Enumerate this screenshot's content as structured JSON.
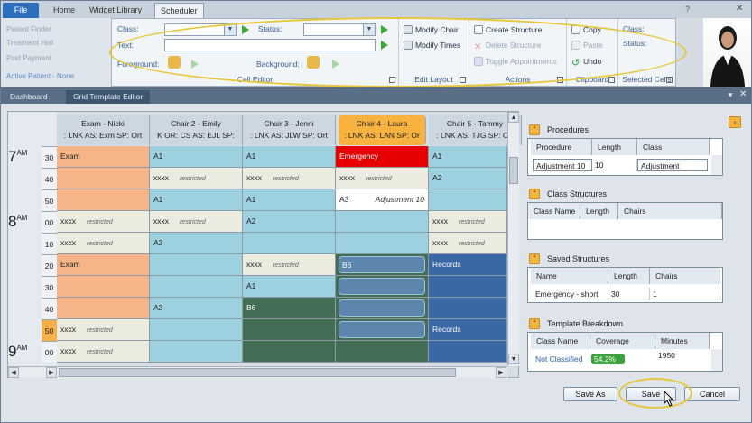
{
  "tabs": {
    "file": "File",
    "home": "Home",
    "widget": "Widget Library",
    "scheduler": "Scheduler"
  },
  "left_ribbon": [
    "Patient Finder",
    "Treatment Hist",
    "Post Payment",
    "Active Patient - None"
  ],
  "cell_editor": {
    "class_label": "Class:",
    "status_label": "Status:",
    "text_label": "Text:",
    "foreground_label": "Foreground:",
    "background_label": "Background:",
    "caption": "Cell Editor"
  },
  "edit_layout": {
    "modify_chair": "Modify Chair",
    "modify_times": "Modify Times",
    "caption": "Edit Layout"
  },
  "actions": {
    "create": "Create Structure",
    "delete": "Delete Structure",
    "toggle": "Toggle Appointments",
    "caption": "Actions"
  },
  "clipboard": {
    "copy": "Copy",
    "paste": "Paste",
    "undo": "Undo",
    "caption": "Clipboard"
  },
  "selected_cells": {
    "class_label": "Class:",
    "status_label": "Status:",
    "caption": "Selected Cells"
  },
  "doc_tabs": {
    "dashboard": "Dashboard",
    "editor": "Grid Template Editor"
  },
  "grid": {
    "hours": [
      {
        "h": "7",
        "s": "AM"
      },
      {
        "h": "8",
        "s": "AM"
      },
      {
        "h": "9",
        "s": "AM"
      }
    ],
    "minutes": [
      "30",
      "40",
      "50",
      "00",
      "10",
      "20",
      "30",
      "40",
      "50",
      "00"
    ],
    "highlight_minute_index": 8,
    "columns": [
      {
        "title": "Exam - Nicki",
        "sub": ": LNK  AS: Exm  SP: Ort"
      },
      {
        "title": "Chair 2 - Emily",
        "sub": "K  OR: CS  AS: EJL  SP:"
      },
      {
        "title": "Chair 3 - Jenni",
        "sub": ": LNK  AS: JLW  SP: Ort"
      },
      {
        "title": "Chair 4 - Laura",
        "sub": ": LNK  AS: LAN  SP: Or"
      },
      {
        "title": "Chair 5 - Tammy",
        "sub": ": LNK  AS: TJG  SP: Ort"
      }
    ],
    "selected_column": 3,
    "cells": [
      [
        {
          "t": "Exam",
          "c": "#f7b489"
        },
        {
          "t": "A1",
          "c": "#9dd1df"
        },
        {
          "t": "A1",
          "c": "#9dd1df"
        },
        {
          "t": "Emergency",
          "c": "#e60000",
          "fg": "#fff"
        },
        {
          "t": "A1",
          "c": "#9dd1df"
        }
      ],
      [
        {
          "t": "",
          "c": "#f7b489"
        },
        {
          "t": "xxxx",
          "r": "restricted",
          "c": "#ecebe0"
        },
        {
          "t": "xxxx",
          "r": "restricted",
          "c": "#ecebe0"
        },
        {
          "t": "xxxx",
          "r": "restricted",
          "c": "#ecebe0"
        },
        {
          "t": "A2",
          "c": "#9dd1df"
        }
      ],
      [
        {
          "t": "",
          "c": "#f7b489"
        },
        {
          "t": "A1",
          "c": "#9dd1df"
        },
        {
          "t": "A1",
          "c": "#9dd1df"
        },
        {
          "t": "A3",
          "n": "Adjustment 10",
          "c": "#ffffff"
        },
        {
          "t": "",
          "c": "#9dd1df"
        }
      ],
      [
        {
          "t": "xxxx",
          "r": "restricted",
          "c": "#ecebe0"
        },
        {
          "t": "xxxx",
          "r": "restricted",
          "c": "#ecebe0"
        },
        {
          "t": "A2",
          "c": "#9dd1df"
        },
        {
          "t": "",
          "c": "#9dd1df"
        },
        {
          "t": "xxxx",
          "r": "restricted",
          "c": "#ecebe0"
        }
      ],
      [
        {
          "t": "xxxx",
          "r": "restricted",
          "c": "#ecebe0"
        },
        {
          "t": "A3",
          "c": "#9dd1df"
        },
        {
          "t": "",
          "c": "#9dd1df"
        },
        {
          "t": "",
          "c": "#9dd1df"
        },
        {
          "t": "xxxx",
          "r": "restricted",
          "c": "#ecebe0"
        }
      ],
      [
        {
          "t": "Exam",
          "c": "#f7b489"
        },
        {
          "t": "",
          "c": "#9dd1df"
        },
        {
          "t": "xxxx",
          "r": "restricted",
          "c": "#ecebe0"
        },
        {
          "t": "B6",
          "c": "#436e55",
          "blk": true
        },
        {
          "t": "Records",
          "c": "#3a67a6",
          "fg": "#fff"
        }
      ],
      [
        {
          "t": "",
          "c": "#f7b489"
        },
        {
          "t": "",
          "c": "#9dd1df"
        },
        {
          "t": "A1",
          "c": "#9dd1df"
        },
        {
          "t": "",
          "c": "#436e55",
          "blk": true
        },
        {
          "t": "",
          "c": "#3a67a6"
        }
      ],
      [
        {
          "t": "",
          "c": "#f7b489"
        },
        {
          "t": "A3",
          "c": "#9dd1df"
        },
        {
          "t": "B6",
          "c": "#436e55",
          "fg": "#fff"
        },
        {
          "t": "",
          "c": "#436e55",
          "blk": true
        },
        {
          "t": "",
          "c": "#3a67a6"
        }
      ],
      [
        {
          "t": "xxxx",
          "r": "restricted",
          "c": "#ecebe0"
        },
        {
          "t": "",
          "c": "#9dd1df"
        },
        {
          "t": "",
          "c": "#436e55"
        },
        {
          "t": "",
          "c": "#436e55",
          "blk": true
        },
        {
          "t": "Records",
          "c": "#3a67a6",
          "fg": "#fff"
        }
      ],
      [
        {
          "t": "xxxx",
          "r": "restricted",
          "c": "#ecebe0"
        },
        {
          "t": "",
          "c": "#9dd1df"
        },
        {
          "t": "",
          "c": "#436e55"
        },
        {
          "t": "",
          "c": "#436e55"
        },
        {
          "t": "",
          "c": "#3a67a6"
        }
      ]
    ]
  },
  "panels": {
    "procedures": {
      "title": "Procedures",
      "headers": [
        "Procedure",
        "Length",
        "Class"
      ],
      "row": [
        "Adjustment 10",
        "10",
        "Adjustment"
      ]
    },
    "class_structures": {
      "title": "Class Structures",
      "headers": [
        "Class Name",
        "Length",
        "Chairs"
      ]
    },
    "saved_structures": {
      "title": "Saved Structures",
      "headers": [
        "Name",
        "Length",
        "Chairs"
      ],
      "row": [
        "Emergency - short",
        "30",
        "1"
      ]
    },
    "template_breakdown": {
      "title": "Template Breakdown",
      "headers": [
        "Class Name",
        "Coverage",
        "Minutes"
      ],
      "row": [
        "Not Classified",
        "54.2%",
        "1950"
      ],
      "coverage": 0.542
    }
  },
  "buttons": {
    "save_as": "Save As",
    "save": "Save",
    "cancel": "Cancel"
  },
  "colors": {
    "accent": "#f7b240",
    "highlight_ring": "#e7c73a",
    "file_tab": "#2e6fbd"
  }
}
